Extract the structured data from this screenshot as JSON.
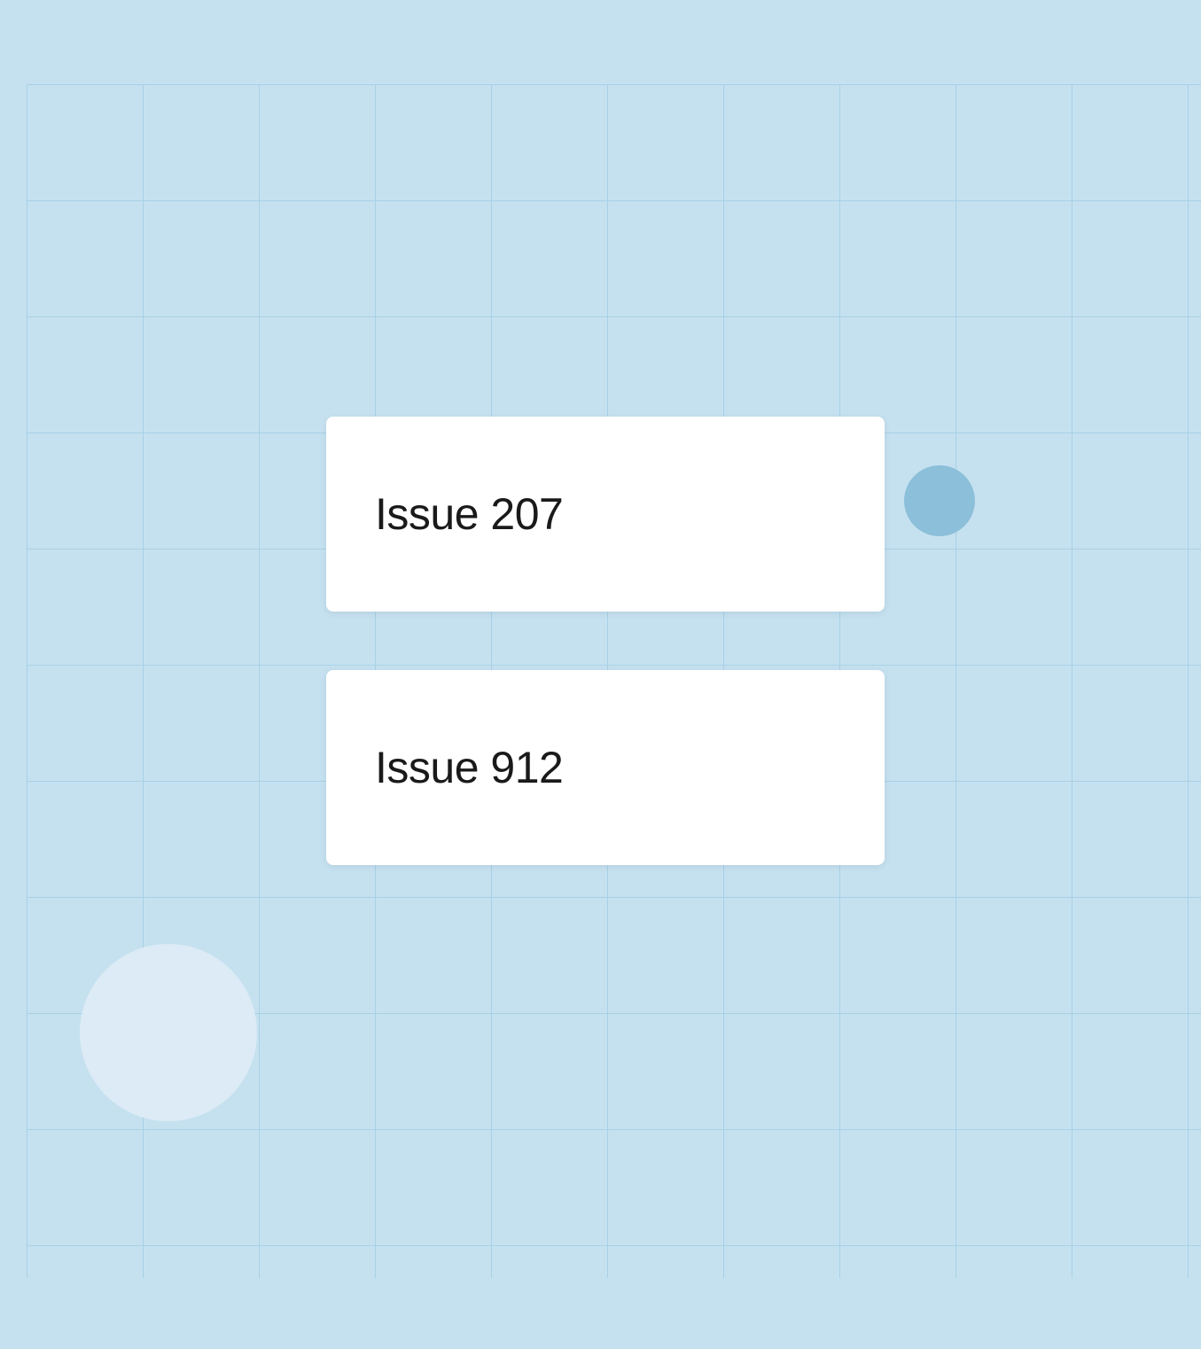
{
  "cards": [
    {
      "title": "Issue 207"
    },
    {
      "title": "Issue 912"
    }
  ],
  "colors": {
    "background": "#c5e1f0",
    "grid": "#a9d0e6",
    "card": "#ffffff",
    "text": "#1a1a1a",
    "circle_small": "#8cbfd9",
    "circle_large": "#dcebf5"
  }
}
